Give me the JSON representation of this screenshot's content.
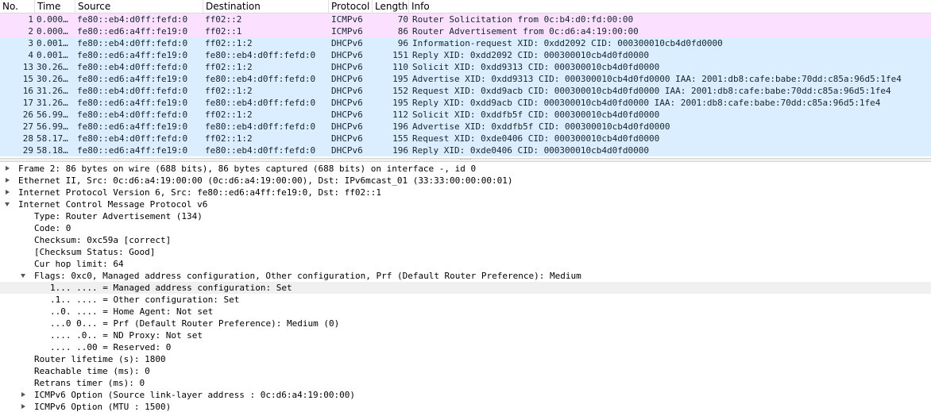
{
  "packet_list": {
    "columns": [
      "No.",
      "Time",
      "Source",
      "Destination",
      "Protocol",
      "Length",
      "Info"
    ],
    "colors": {
      "icmpv6": "#fce0ff",
      "udp": "#daeeff",
      "text": "#12272e"
    },
    "rows": [
      {
        "no": "1",
        "time": "0.000…",
        "src": "fe80::eb4:d0ff:fefd:0",
        "dst": "ff02::2",
        "proto": "ICMPv6",
        "len": "70",
        "info": "Router Solicitation from 0c:b4:d0:fd:00:00",
        "color": "#fce0ff"
      },
      {
        "no": "2",
        "time": "0.000…",
        "src": "fe80::ed6:a4ff:fe19:0",
        "dst": "ff02::1",
        "proto": "ICMPv6",
        "len": "86",
        "info": "Router Advertisement from 0c:d6:a4:19:00:00",
        "color": "#fce0ff"
      },
      {
        "no": "3",
        "time": "0.001…",
        "src": "fe80::eb4:d0ff:fefd:0",
        "dst": "ff02::1:2",
        "proto": "DHCPv6",
        "len": "96",
        "info": "Information-request XID: 0xdd2092 CID: 000300010cb4d0fd0000",
        "color": "#daeeff"
      },
      {
        "no": "4",
        "time": "0.001…",
        "src": "fe80::ed6:a4ff:fe19:0",
        "dst": "fe80::eb4:d0ff:fefd:0",
        "proto": "DHCPv6",
        "len": "151",
        "info": "Reply XID: 0xdd2092 CID: 000300010cb4d0fd0000",
        "color": "#daeeff"
      },
      {
        "no": "13",
        "time": "30.26…",
        "src": "fe80::eb4:d0ff:fefd:0",
        "dst": "ff02::1:2",
        "proto": "DHCPv6",
        "len": "110",
        "info": "Solicit XID: 0xdd9313 CID: 000300010cb4d0fd0000",
        "color": "#daeeff"
      },
      {
        "no": "15",
        "time": "30.26…",
        "src": "fe80::ed6:a4ff:fe19:0",
        "dst": "fe80::eb4:d0ff:fefd:0",
        "proto": "DHCPv6",
        "len": "195",
        "info": "Advertise XID: 0xdd9313 CID: 000300010cb4d0fd0000 IAA: 2001:db8:cafe:babe:70dd:c85a:96d5:1fe4",
        "color": "#daeeff"
      },
      {
        "no": "16",
        "time": "31.26…",
        "src": "fe80::eb4:d0ff:fefd:0",
        "dst": "ff02::1:2",
        "proto": "DHCPv6",
        "len": "152",
        "info": "Request XID: 0xdd9acb CID: 000300010cb4d0fd0000 IAA: 2001:db8:cafe:babe:70dd:c85a:96d5:1fe4",
        "color": "#daeeff"
      },
      {
        "no": "17",
        "time": "31.26…",
        "src": "fe80::ed6:a4ff:fe19:0",
        "dst": "fe80::eb4:d0ff:fefd:0",
        "proto": "DHCPv6",
        "len": "195",
        "info": "Reply XID: 0xdd9acb CID: 000300010cb4d0fd0000 IAA: 2001:db8:cafe:babe:70dd:c85a:96d5:1fe4",
        "color": "#daeeff"
      },
      {
        "no": "26",
        "time": "56.99…",
        "src": "fe80::eb4:d0ff:fefd:0",
        "dst": "ff02::1:2",
        "proto": "DHCPv6",
        "len": "112",
        "info": "Solicit XID: 0xddfb5f CID: 000300010cb4d0fd0000",
        "color": "#daeeff"
      },
      {
        "no": "27",
        "time": "56.99…",
        "src": "fe80::ed6:a4ff:fe19:0",
        "dst": "fe80::eb4:d0ff:fefd:0",
        "proto": "DHCPv6",
        "len": "196",
        "info": "Advertise XID: 0xddfb5f CID: 000300010cb4d0fd0000",
        "color": "#daeeff"
      },
      {
        "no": "28",
        "time": "58.17…",
        "src": "fe80::eb4:d0ff:fefd:0",
        "dst": "ff02::1:2",
        "proto": "DHCPv6",
        "len": "155",
        "info": "Request XID: 0xde0406 CID: 000300010cb4d0fd0000",
        "color": "#daeeff"
      },
      {
        "no": "29",
        "time": "58.18…",
        "src": "fe80::ed6:a4ff:fe19:0",
        "dst": "fe80::eb4:d0ff:fefd:0",
        "proto": "DHCPv6",
        "len": "196",
        "info": "Reply XID: 0xde0406 CID: 000300010cb4d0fd0000",
        "color": "#daeeff"
      }
    ]
  },
  "details": {
    "rows": [
      {
        "indent": 0,
        "arrow": "right",
        "text": "Frame 2: 86 bytes on wire (688 bits), 86 bytes captured (688 bits) on interface -, id 0"
      },
      {
        "indent": 0,
        "arrow": "right",
        "text": "Ethernet II, Src: 0c:d6:a4:19:00:00 (0c:d6:a4:19:00:00), Dst: IPv6mcast_01 (33:33:00:00:00:01)"
      },
      {
        "indent": 0,
        "arrow": "right",
        "text": "Internet Protocol Version 6, Src: fe80::ed6:a4ff:fe19:0, Dst: ff02::1"
      },
      {
        "indent": 0,
        "arrow": "down",
        "text": "Internet Control Message Protocol v6"
      },
      {
        "indent": 1,
        "arrow": "none",
        "text": "Type: Router Advertisement (134)"
      },
      {
        "indent": 1,
        "arrow": "none",
        "text": "Code: 0"
      },
      {
        "indent": 1,
        "arrow": "none",
        "text": "Checksum: 0xc59a [correct]"
      },
      {
        "indent": 1,
        "arrow": "none",
        "text": "[Checksum Status: Good]"
      },
      {
        "indent": 1,
        "arrow": "none",
        "text": "Cur hop limit: 64"
      },
      {
        "indent": 1,
        "arrow": "down",
        "text": "Flags: 0xc0, Managed address configuration, Other configuration, Prf (Default Router Preference): Medium"
      },
      {
        "indent": 2,
        "arrow": "none",
        "text": "1... .... = Managed address configuration: Set",
        "selected": true
      },
      {
        "indent": 2,
        "arrow": "none",
        "text": ".1.. .... = Other configuration: Set"
      },
      {
        "indent": 2,
        "arrow": "none",
        "text": "..0. .... = Home Agent: Not set"
      },
      {
        "indent": 2,
        "arrow": "none",
        "text": "...0 0... = Prf (Default Router Preference): Medium (0)"
      },
      {
        "indent": 2,
        "arrow": "none",
        "text": ".... .0.. = ND Proxy: Not set"
      },
      {
        "indent": 2,
        "arrow": "none",
        "text": ".... ..00 = Reserved: 0"
      },
      {
        "indent": 1,
        "arrow": "none",
        "text": "Router lifetime (s): 1800"
      },
      {
        "indent": 1,
        "arrow": "none",
        "text": "Reachable time (ms): 0"
      },
      {
        "indent": 1,
        "arrow": "none",
        "text": "Retrans timer (ms): 0"
      },
      {
        "indent": 1,
        "arrow": "right",
        "text": "ICMPv6 Option (Source link-layer address : 0c:d6:a4:19:00:00)"
      },
      {
        "indent": 1,
        "arrow": "right",
        "text": "ICMPv6 Option (MTU : 1500)"
      }
    ]
  }
}
